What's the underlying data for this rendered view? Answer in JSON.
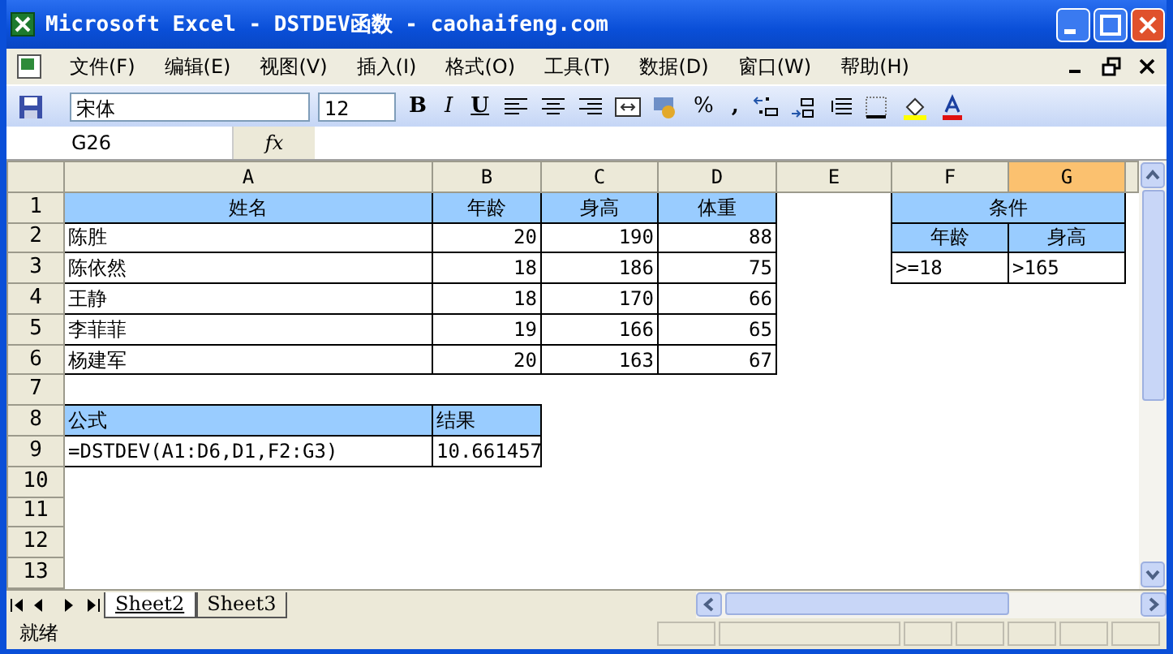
{
  "window": {
    "title": "Microsoft Excel - DSTDEV函数 - caohaifeng.com"
  },
  "menu": [
    "文件(F)",
    "编辑(E)",
    "视图(V)",
    "插入(I)",
    "格式(O)",
    "工具(T)",
    "数据(D)",
    "窗口(W)",
    "帮助(H)"
  ],
  "toolbar": {
    "font": "宋体",
    "size": "12",
    "format_buttons": [
      "B",
      "I",
      "U"
    ],
    "number_buttons": [
      "%",
      ","
    ]
  },
  "formula_bar": {
    "name_box": "G26",
    "fx": "fx"
  },
  "columns": [
    {
      "label": "A",
      "selected": false
    },
    {
      "label": "B",
      "selected": false
    },
    {
      "label": "C",
      "selected": false
    },
    {
      "label": "D",
      "selected": false
    },
    {
      "label": "E",
      "selected": false
    },
    {
      "label": "F",
      "selected": false
    },
    {
      "label": "G",
      "selected": true
    }
  ],
  "rows": [
    {
      "number": "1",
      "cells": [
        {
          "kind": "header",
          "text": "姓名"
        },
        {
          "kind": "header",
          "text": "年龄"
        },
        {
          "kind": "header",
          "text": "身高"
        },
        {
          "kind": "header",
          "text": "体重"
        },
        {
          "kind": "blank"
        },
        {
          "kind": "header_wide",
          "text": "条件"
        }
      ]
    },
    {
      "number": "2",
      "cells": [
        {
          "kind": "text",
          "text": "陈胜"
        },
        {
          "kind": "number",
          "text": "20"
        },
        {
          "kind": "number",
          "text": "190"
        },
        {
          "kind": "number",
          "text": "88"
        },
        {
          "kind": "blank"
        },
        {
          "kind": "header",
          "text": "年龄"
        },
        {
          "kind": "header",
          "text": "身高"
        }
      ]
    },
    {
      "number": "3",
      "cells": [
        {
          "kind": "text",
          "text": "陈依然"
        },
        {
          "kind": "number",
          "text": "18"
        },
        {
          "kind": "number",
          "text": "186"
        },
        {
          "kind": "number",
          "text": "75"
        },
        {
          "kind": "blank"
        },
        {
          "kind": "text",
          "text": ">=18"
        },
        {
          "kind": "text",
          "text": ">165"
        }
      ]
    },
    {
      "number": "4",
      "cells": [
        {
          "kind": "text",
          "text": "王静"
        },
        {
          "kind": "number",
          "text": "18"
        },
        {
          "kind": "number",
          "text": "170"
        },
        {
          "kind": "number",
          "text": "66"
        }
      ]
    },
    {
      "number": "5",
      "cells": [
        {
          "kind": "text",
          "text": "李菲菲"
        },
        {
          "kind": "number",
          "text": "19"
        },
        {
          "kind": "number",
          "text": "166"
        },
        {
          "kind": "number",
          "text": "65"
        }
      ]
    },
    {
      "number": "6",
      "cells": [
        {
          "kind": "text",
          "text": "杨建军"
        },
        {
          "kind": "number",
          "text": "20"
        },
        {
          "kind": "number",
          "text": "163"
        },
        {
          "kind": "number",
          "text": "67"
        }
      ]
    },
    {
      "number": "7"
    },
    {
      "number": "8",
      "cells": [
        {
          "kind": "header_left",
          "text": "公式"
        },
        {
          "kind": "header_left",
          "text": "结果"
        }
      ]
    },
    {
      "number": "9",
      "cells": [
        {
          "kind": "text",
          "text": "=DSTDEV(A1:D6,D1,F2:G3)"
        },
        {
          "kind": "text",
          "text": "10.661457"
        }
      ]
    },
    {
      "number": "10"
    },
    {
      "number": "11"
    },
    {
      "number": "12"
    },
    {
      "number": "13"
    }
  ],
  "sheets": [
    {
      "label": "Sheet2",
      "selected": true
    },
    {
      "label": "Sheet3",
      "selected": false
    }
  ],
  "status_bar": {
    "text": "就绪"
  }
}
